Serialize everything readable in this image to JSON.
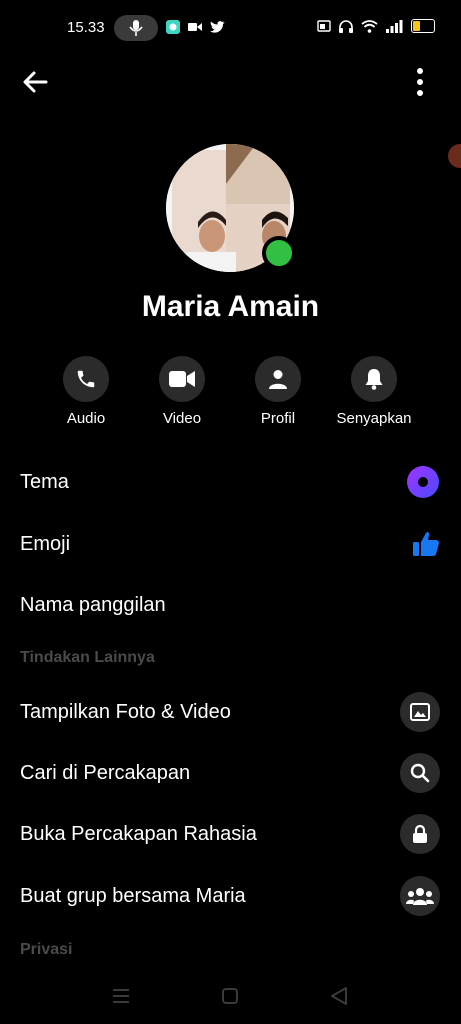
{
  "status_bar": {
    "time": "15.33",
    "battery_percent": 40,
    "battery_color": "#f5c518"
  },
  "profile": {
    "name": "Maria Amain",
    "online_color": "#31c041"
  },
  "actions": [
    {
      "label": "Audio",
      "icon": "phone-icon"
    },
    {
      "label": "Video",
      "icon": "video-camera-icon"
    },
    {
      "label": "Profil",
      "icon": "person-icon"
    },
    {
      "label": "Senyapkan",
      "icon": "bell-icon"
    }
  ],
  "settings": {
    "theme": {
      "label": "Tema",
      "icon": "theme-circle-icon"
    },
    "emoji": {
      "label": "Emoji",
      "icon": "thumbs-up-icon"
    },
    "nickname": {
      "label": "Nama panggilan"
    }
  },
  "more_actions": {
    "header": "Tindakan Lainnya",
    "items": [
      {
        "label": "Tampilkan Foto & Video",
        "icon": "image-icon"
      },
      {
        "label": "Cari di Percakapan",
        "icon": "search-icon"
      },
      {
        "label": "Buka Percakapan Rahasia",
        "icon": "lock-icon"
      },
      {
        "label": "Buat grup bersama Maria",
        "icon": "group-icon"
      }
    ]
  },
  "privacy": {
    "header": "Privasi"
  },
  "colors": {
    "accent_blue": "#1877f2",
    "theme_purple": "#7b3fe4"
  }
}
